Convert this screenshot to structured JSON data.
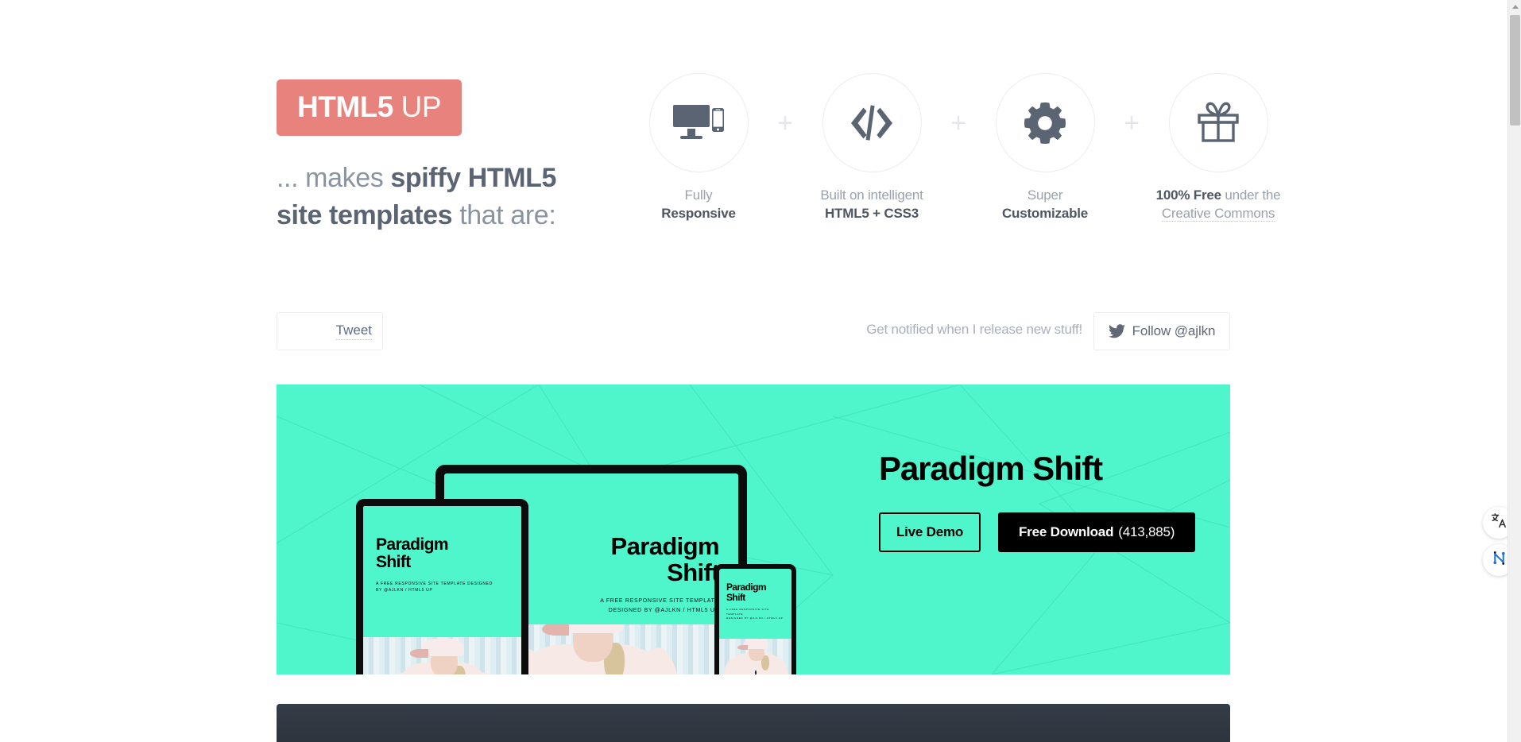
{
  "brand": {
    "name_strong": "HTML5",
    "name_light": " UP",
    "badge_color": "#e8827c"
  },
  "tagline": {
    "line1_pre": "... makes ",
    "line1_bold": "spiffy HTML5",
    "line2_bold": "site templates",
    "line2_post": " that are:"
  },
  "features": [
    {
      "icon": "devices-icon",
      "label_top": "Fully",
      "label_bottom": "Responsive"
    },
    {
      "icon": "code-icon",
      "label_top": "Built on intelligent",
      "label_bottom": "HTML5 + CSS3"
    },
    {
      "icon": "gear-icon",
      "label_top": "Super",
      "label_bottom": "Customizable"
    },
    {
      "icon": "gift-icon",
      "label_top_bold": "100% Free",
      "label_top_rest": " under the",
      "label_bottom": "Creative Commons"
    }
  ],
  "separator": "+",
  "social": {
    "tweet_label": "Tweet",
    "notify_text": "Get notified when I release new stuff!",
    "follow_label": "Follow @ajlkn",
    "follow_icon": "twitter-bird-icon"
  },
  "showcase": {
    "background_color": "#4ff5cb",
    "title": "Paradigm Shift",
    "demo_label": "Live Demo",
    "download_label": "Free Download",
    "download_count": "(413,885)",
    "devices": [
      {
        "type": "laptop",
        "screen_title": "Paradigm Shift",
        "screen_sub_line1": "A FREE RESPONSIVE SITE TEMPLATE",
        "screen_sub_line2": "DESIGNED BY @AJLKN / HTML5 UP",
        "arrow": "↓"
      },
      {
        "type": "tablet",
        "screen_title": "Paradigm Shift",
        "screen_sub_line1": "A FREE RESPONSIVE SITE TEMPLATE DESIGNED",
        "screen_sub_line2": "BY @AJLKN / HTML5 UP"
      },
      {
        "type": "phone",
        "screen_title": "Paradigm Shift",
        "screen_sub_line1": "A FREE RESPONSIVE SITE TEMPLATE",
        "screen_sub_line2": "DESIGNED BY @AJLKN / HTML5 UP"
      }
    ]
  },
  "side_buttons": [
    {
      "icon": "translate-icon",
      "color": "#2b2b2b"
    },
    {
      "icon": "ai-network-icon",
      "color": "#1a73e8"
    }
  ],
  "dark_panel": {
    "color": "#2e343d"
  }
}
